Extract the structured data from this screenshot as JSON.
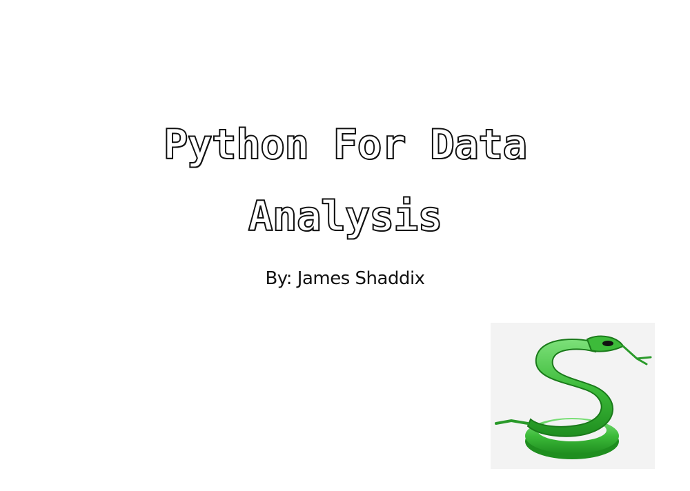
{
  "slide": {
    "title_line1": "Python For Data",
    "title_line2": "Analysis",
    "subtitle": "By: James Shaddix",
    "logo_icon": "snake-icon",
    "logo_color": "#33b533"
  }
}
